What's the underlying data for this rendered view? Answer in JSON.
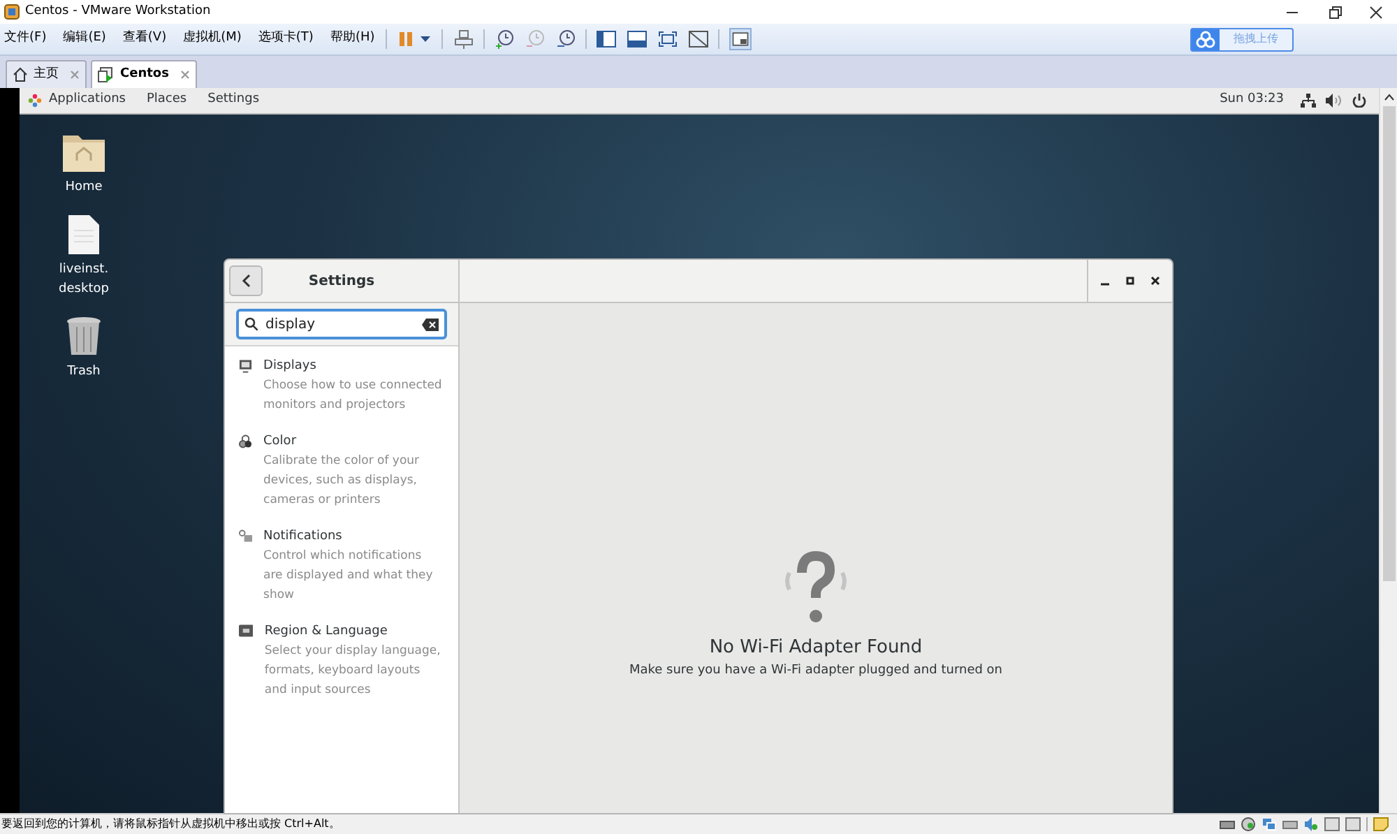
{
  "window": {
    "title": "Centos - VMware Workstation"
  },
  "menu": [
    "文件(F)",
    "编辑(E)",
    "查看(V)",
    "虚拟机(M)",
    "选项卡(T)",
    "帮助(H)"
  ],
  "upload_button": {
    "label": "拖拽上传"
  },
  "tabs": [
    {
      "label": "主页",
      "kind": "home",
      "selected": false
    },
    {
      "label": "Centos",
      "kind": "vm",
      "selected": true
    }
  ],
  "gnome_bar": {
    "menus": [
      "Applications",
      "Places",
      "Settings"
    ],
    "clock": "Sun 03:23"
  },
  "desktop_icons": [
    {
      "label": "Home",
      "kind": "folder"
    },
    {
      "label": "liveinst.\ndesktop",
      "kind": "file"
    },
    {
      "label": "Trash",
      "kind": "trash"
    }
  ],
  "settings": {
    "title": "Settings",
    "search": {
      "value": "display"
    },
    "results": [
      {
        "kind": "display",
        "name": "Displays",
        "description": "Choose how to use connected monitors and projectors"
      },
      {
        "kind": "color",
        "name": "Color",
        "description": "Calibrate the color of your devices, such as displays, cameras or printers"
      },
      {
        "kind": "notifications",
        "name": "Notifications",
        "description": "Control which notifications are displayed and what they show"
      },
      {
        "kind": "region",
        "name": "Region & Language",
        "description": "Select your display language, formats, keyboard layouts and input sources"
      }
    ],
    "empty_state": {
      "title": "No Wi-Fi Adapter Found",
      "subtitle": "Make sure you have a Wi-Fi adapter plugged and turned on"
    }
  },
  "status_bar": {
    "text": "要返回到您的计算机，请将鼠标指针从虚拟机中移出或按 Ctrl+Alt。"
  }
}
